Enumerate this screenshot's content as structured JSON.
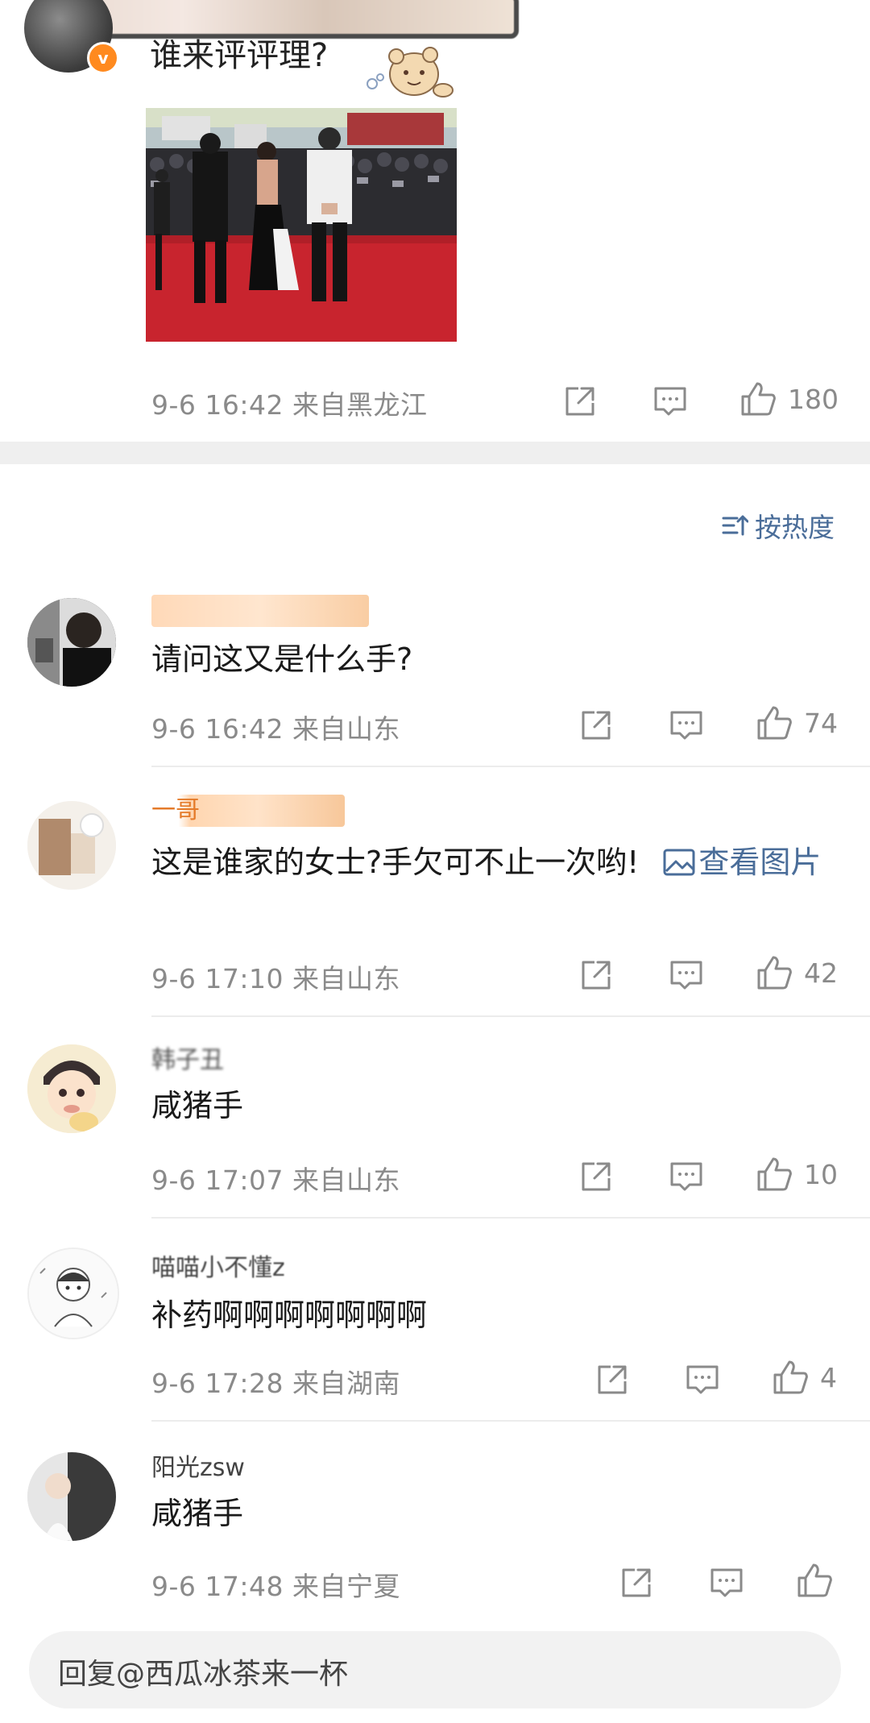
{
  "post": {
    "caption": "谁来评评理?",
    "meta": "9-6 16:42 来自黑龙江",
    "likes": "180",
    "icons": {
      "share": "share-icon",
      "comment": "comment-icon",
      "like": "thumbs-up-icon"
    }
  },
  "sort": {
    "label": "按热度"
  },
  "comments": [
    {
      "text": "请问这又是什么手?",
      "meta": "9-6 16:42 来自山东",
      "likes": "74"
    },
    {
      "name": "一哥",
      "text": "这是谁家的女士?手欠可不止一次哟!",
      "link": "查看图片",
      "meta": "9-6 17:10 来自山东",
      "likes": "42"
    },
    {
      "name": "韩子丑",
      "text": "咸猪手",
      "meta": "9-6 17:07 来自山东",
      "likes": "10"
    },
    {
      "name": "喵喵小不懂z",
      "text": "补药啊啊啊啊啊啊啊",
      "meta": "9-6 17:28 来自湖南",
      "likes": "4"
    },
    {
      "name": "阳光zsw",
      "text": "咸猪手",
      "meta": "9-6 17:48 来自宁夏",
      "likes": ""
    }
  ],
  "reply": {
    "placeholder": "回复@西瓜冰茶来一杯"
  },
  "colors": {
    "link": "#4a6d99",
    "meta": "#8a8a8a",
    "verified": "#ff8a1f",
    "gap": "#efefef"
  }
}
